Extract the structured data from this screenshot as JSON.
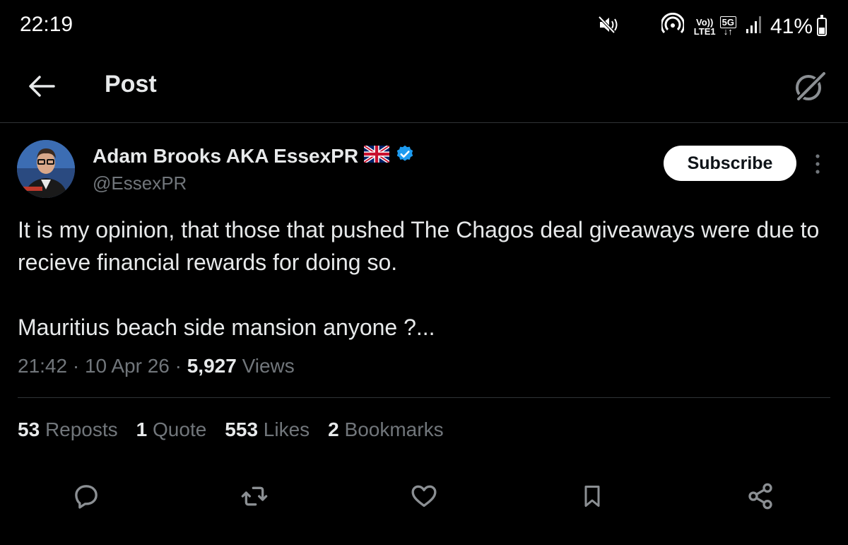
{
  "status_bar": {
    "time": "22:19",
    "network_top": "Vo))",
    "network_bottom": "LTE1",
    "network_gen": "5G",
    "battery_percent": "41%",
    "battery_level": 0.41,
    "icons": [
      "mute-icon",
      "hotspot-icon",
      "signal-icon",
      "battery-icon"
    ]
  },
  "header": {
    "title": "Post",
    "back_icon": "arrow-left-icon",
    "grok_icon": "grok-icon"
  },
  "post": {
    "author_name": "Adam Brooks AKA EssexPR",
    "author_flag": "uk-flag-icon",
    "verified_icon": "verified-badge-icon",
    "handle": "@EssexPR",
    "subscribe_label": "Subscribe",
    "text_paragraph_1": "It is my opinion, that those that pushed The Chagos deal giveaways were due to recieve financial rewards for doing so.",
    "text_paragraph_2": "Mauritius beach side mansion anyone ?...",
    "time": "21:42",
    "date": "10 Apr 26",
    "views_count": "5,927",
    "views_label": "Views",
    "stats": {
      "reposts_count": "53",
      "reposts_label": "Reposts",
      "quotes_count": "1",
      "quotes_label": "Quote",
      "likes_count": "553",
      "likes_label": "Likes",
      "bookmarks_count": "2",
      "bookmarks_label": "Bookmarks"
    }
  },
  "actions": [
    "reply-icon",
    "repost-icon",
    "like-icon",
    "bookmark-icon",
    "share-icon"
  ],
  "colors": {
    "background": "#000000",
    "text_primary": "#e7e9ea",
    "text_secondary": "#71767b",
    "divider": "#2f3336",
    "verified_blue": "#1d9bf0"
  }
}
